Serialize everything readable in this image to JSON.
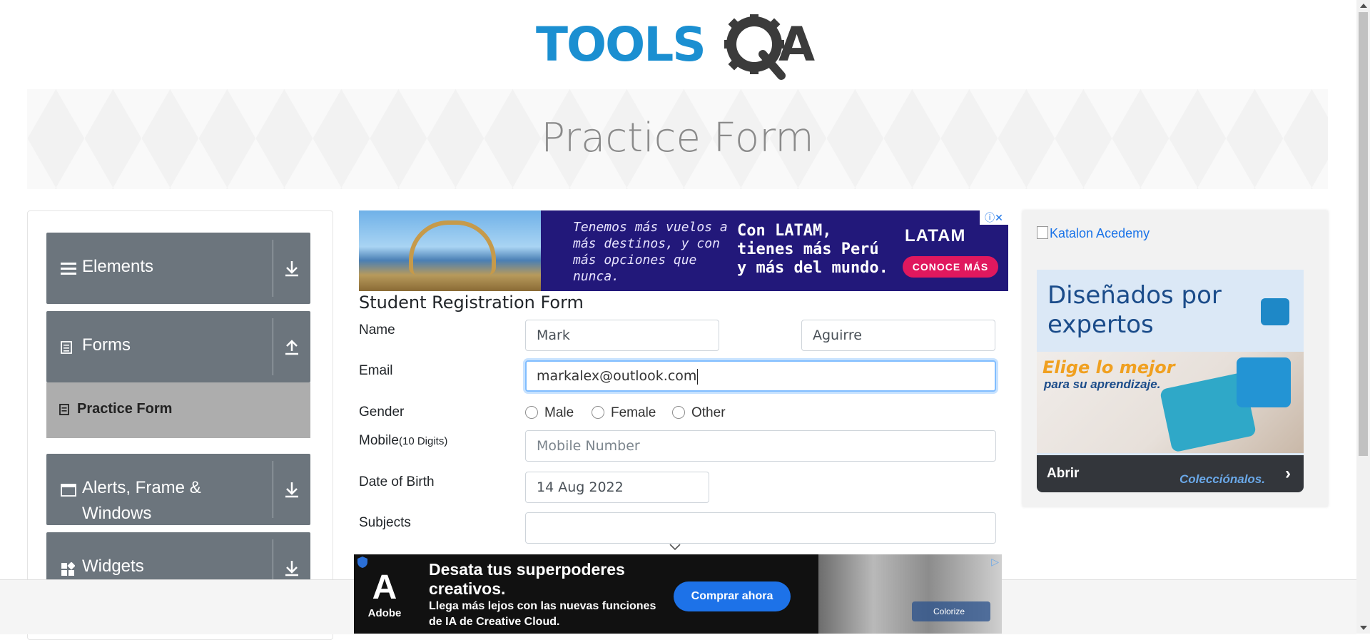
{
  "header": {
    "logo_text_left": "TOOLS",
    "logo_text_right": "A",
    "logo_alt": "ToolsQA logo"
  },
  "banner": {
    "title": "Practice Form"
  },
  "sidebar": {
    "groups": [
      {
        "label": "Elements",
        "icon": "hamburger-icon",
        "expanded": false
      },
      {
        "label": "Forms",
        "icon": "document-icon",
        "expanded": true
      },
      {
        "label": "Alerts, Frame & Windows",
        "icon": "window-icon",
        "expanded": false
      },
      {
        "label": "Widgets",
        "icon": "widgets-icon",
        "expanded": false
      }
    ],
    "forms_subitem": {
      "label": "Practice Form",
      "icon": "form-icon"
    }
  },
  "ads": {
    "top": {
      "tagline": "Tenemos más vuelos a más destinos, y con más opciones que nunca.",
      "headline": "Con LATAM, tienes más Perú y más del mundo.",
      "brand": "LATAM",
      "cta": "CONOCE MÁS"
    },
    "right": {
      "katalon_alt": "Katalon Acedemy",
      "headline": "Diseñados por expertos",
      "promo_1": "Elige lo mejor",
      "promo_2": "para su aprendizaje.",
      "cta": "Abrir",
      "collection": "Colecciónalos."
    },
    "bottom": {
      "brand": "Adobe",
      "headline": "Desata tus superpoderes creativos.",
      "subline": "Llega más lejos con las nuevas funciones de IA de Creative Cloud.",
      "cta": "Comprar ahora",
      "badge": "Colorize"
    }
  },
  "form": {
    "title": "Student Registration Form",
    "name_label": "Name",
    "first_name": "Mark",
    "last_name": "Aguirre",
    "email_label": "Email",
    "email_value": "markalex@outlook.com",
    "gender_label": "Gender",
    "gender_options": [
      "Male",
      "Female",
      "Other"
    ],
    "mobile_label": "Mobile",
    "mobile_hint": "(10 Digits)",
    "mobile_placeholder": "Mobile Number",
    "dob_label": "Date of Birth",
    "dob_value": "14 Aug 2022",
    "subjects_label": "Subjects",
    "subjects_value": ""
  },
  "colors": {
    "sidebar_group": "#6c757d",
    "sidebar_active_item": "#adadad",
    "focus_border": "#80bdff",
    "logo_blue": "#1b8fd1",
    "logo_dark": "#3b3b3b"
  }
}
